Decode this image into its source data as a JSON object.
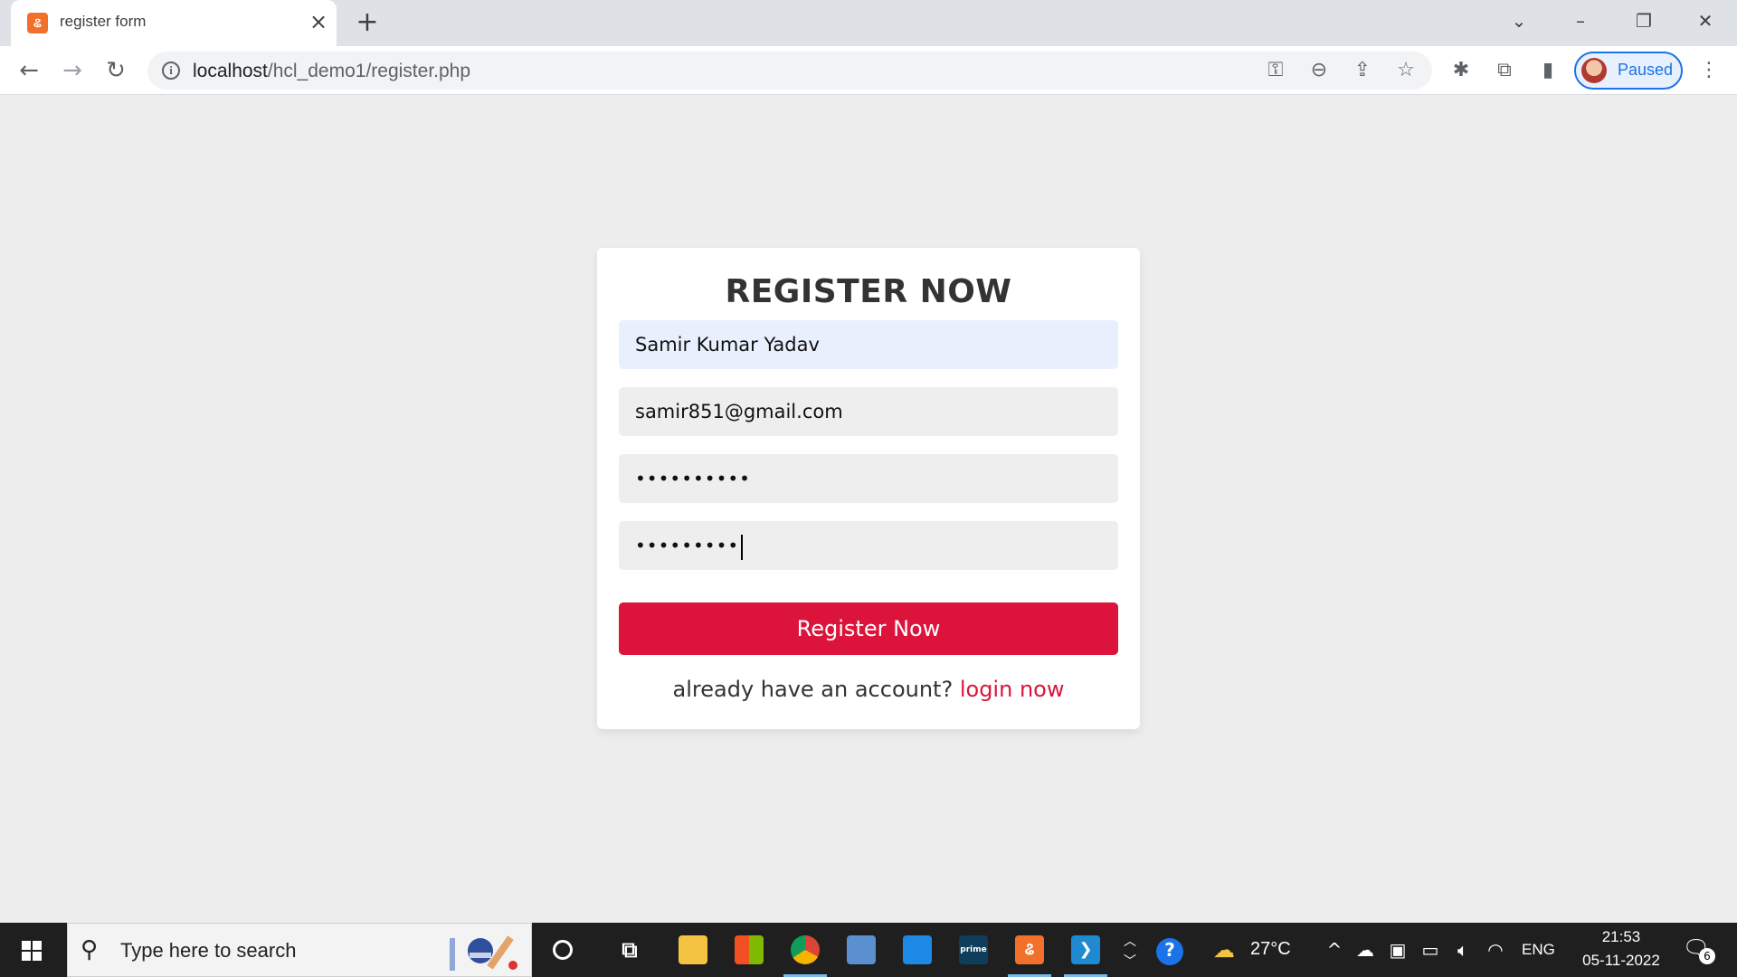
{
  "browser": {
    "tab_title": "register form",
    "url_host": "localhost",
    "url_path": "/hcl_demo1/register.php",
    "profile_label": "Paused"
  },
  "form": {
    "title": "REGISTER NOW",
    "name_value": "Samir Kumar Yadav",
    "email_value": "samir851@gmail.com",
    "password_mask": "••••••••••",
    "confirm_password_mask": "•••••••••",
    "submit_label": "Register Now",
    "login_prompt": "already have an account?",
    "login_link": "login now"
  },
  "taskbar": {
    "search_placeholder": "Type here to search",
    "temperature": "27°C",
    "language": "ENG",
    "time": "21:53",
    "date": "05-11-2022",
    "notification_count": "6"
  },
  "colors": {
    "accent": "#dc143c",
    "autofill_bg": "#e8f0fe",
    "field_bg": "#eeeeee",
    "page_bg": "#ededed"
  },
  "icons": [
    "xampp-icon",
    "close-icon",
    "plus-icon",
    "back-icon",
    "forward-icon",
    "reload-icon",
    "info-icon",
    "key-icon",
    "zoom-out-icon",
    "share-icon",
    "star-icon",
    "bug-icon",
    "puzzle-icon",
    "side-panel-icon",
    "menu-icon",
    "windows-icon",
    "search-icon",
    "cortana-icon",
    "task-view-icon",
    "file-explorer-icon",
    "store-icon",
    "chrome-icon",
    "help-icon",
    "weather-icon",
    "notification-icon"
  ]
}
